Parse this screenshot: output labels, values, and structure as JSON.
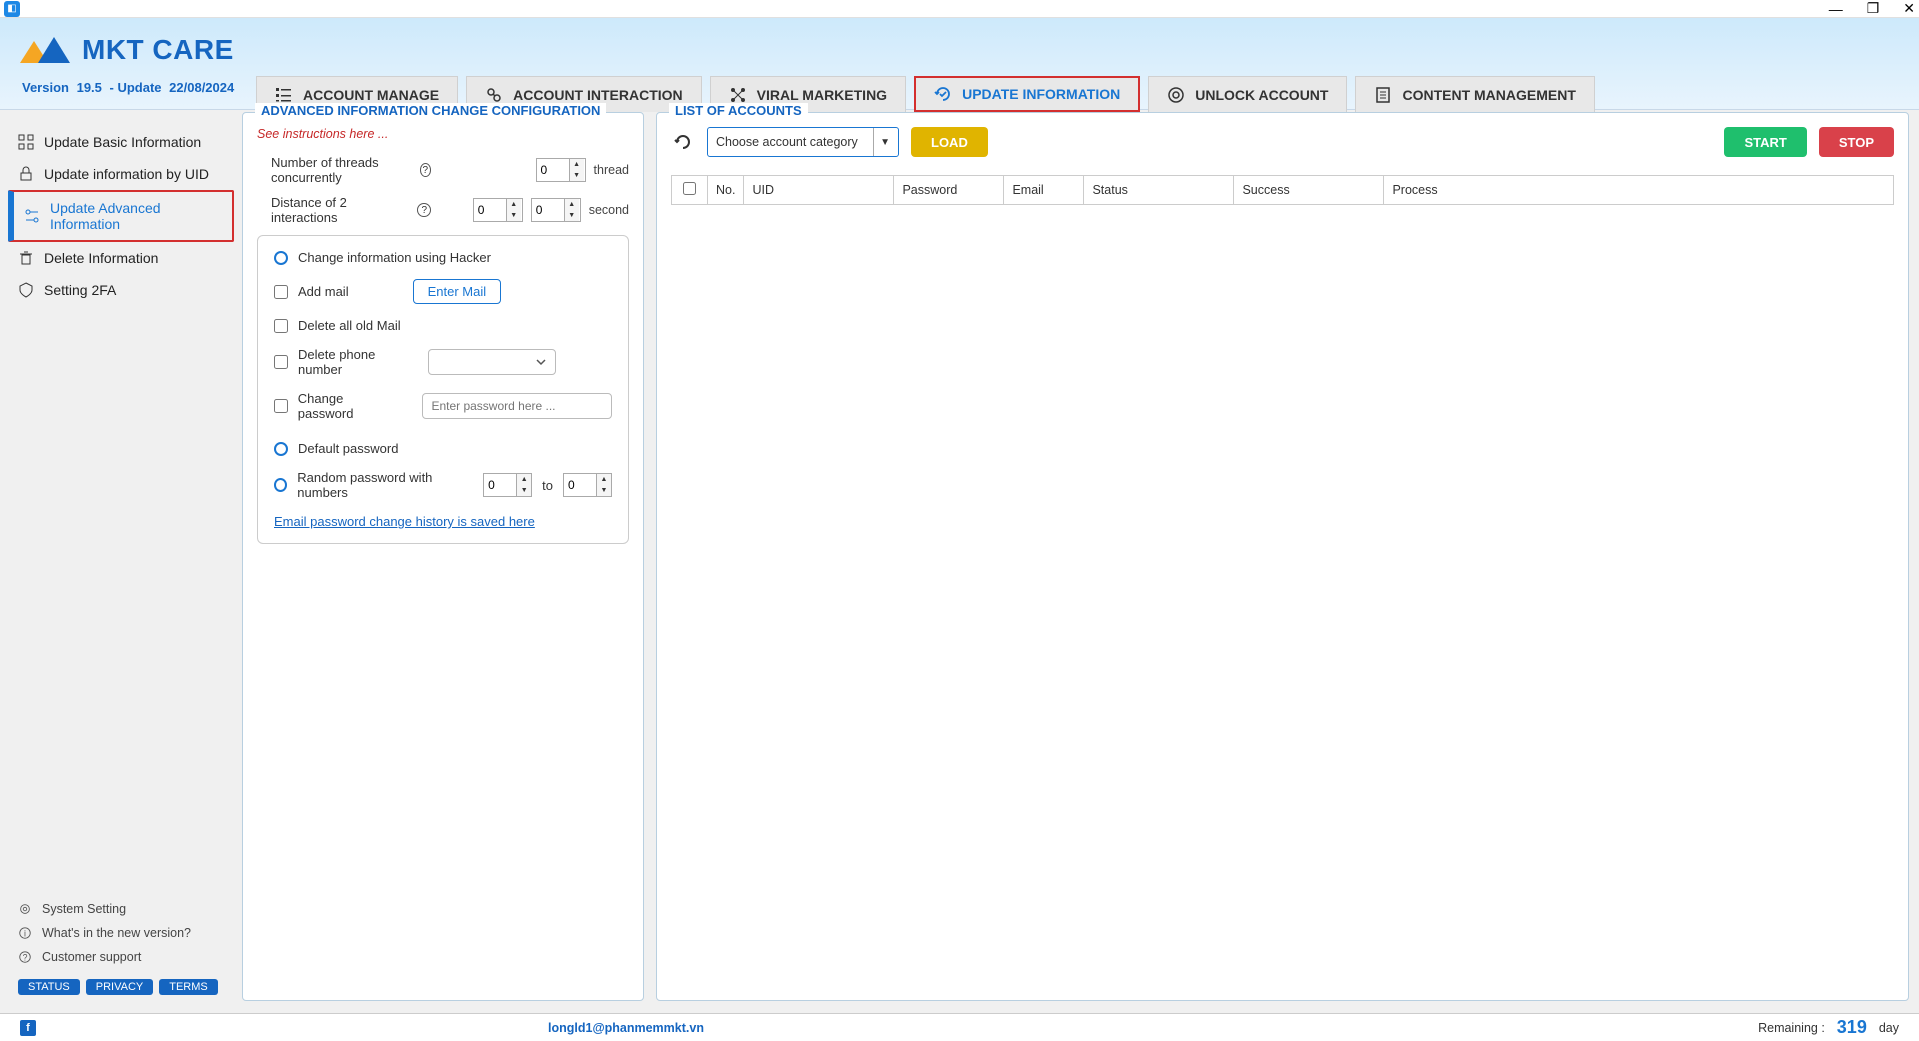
{
  "app": {
    "brand": "MKT CARE",
    "version_label": "Version",
    "version": "19.5",
    "update_label": "- Update",
    "update_date": "22/08/2024"
  },
  "top_tabs": [
    {
      "label": "ACCOUNT MANAGE"
    },
    {
      "label": "ACCOUNT INTERACTION"
    },
    {
      "label": "VIRAL MARKETING"
    },
    {
      "label": "UPDATE INFORMATION"
    },
    {
      "label": "UNLOCK ACCOUNT"
    },
    {
      "label": "CONTENT MANAGEMENT"
    }
  ],
  "sidebar": {
    "items": [
      {
        "label": "Update Basic Information"
      },
      {
        "label": "Update information by UID"
      },
      {
        "label": "Update Advanced Information"
      },
      {
        "label": "Delete Information"
      },
      {
        "label": "Setting 2FA"
      }
    ],
    "bottom": [
      {
        "label": "System Setting"
      },
      {
        "label": "What's in the new version?"
      },
      {
        "label": "Customer support"
      }
    ],
    "badges": [
      "STATUS",
      "PRIVACY",
      "TERMS"
    ]
  },
  "left_panel": {
    "title": "ADVANCED INFORMATION CHANGE CONFIGURATION",
    "instruction": "See instructions here ...",
    "threads_label": "Number of threads concurrently",
    "threads_value": "0",
    "threads_unit": "thread",
    "distance_label": "Distance of 2 interactions",
    "distance_from": "0",
    "distance_to": "0",
    "distance_unit": "second",
    "opt_change_hacker": "Change information using Hacker",
    "opt_add_mail": "Add mail",
    "enter_mail_btn": "Enter Mail",
    "opt_delete_old_mail": "Delete all old Mail",
    "opt_delete_phone": "Delete phone number",
    "opt_change_password": "Change password",
    "password_placeholder": "Enter password here ...",
    "opt_default_password": "Default password",
    "opt_random_password": "Random password with numbers",
    "random_from": "0",
    "random_to_label": "to",
    "random_to": "0",
    "history_link": "Email password change history is saved here"
  },
  "right_panel": {
    "title": "LIST OF ACCOUNTS",
    "category_placeholder": "Choose account category",
    "load_btn": "LOAD",
    "start_btn": "START",
    "stop_btn": "STOP",
    "columns": [
      "No.",
      "UID",
      "Password",
      "Email",
      "Status",
      "Success",
      "Process"
    ]
  },
  "statusbar": {
    "email": "longld1@phanmemmkt.vn",
    "remaining_label": "Remaining :",
    "remaining_value": "319",
    "remaining_unit": "day"
  }
}
